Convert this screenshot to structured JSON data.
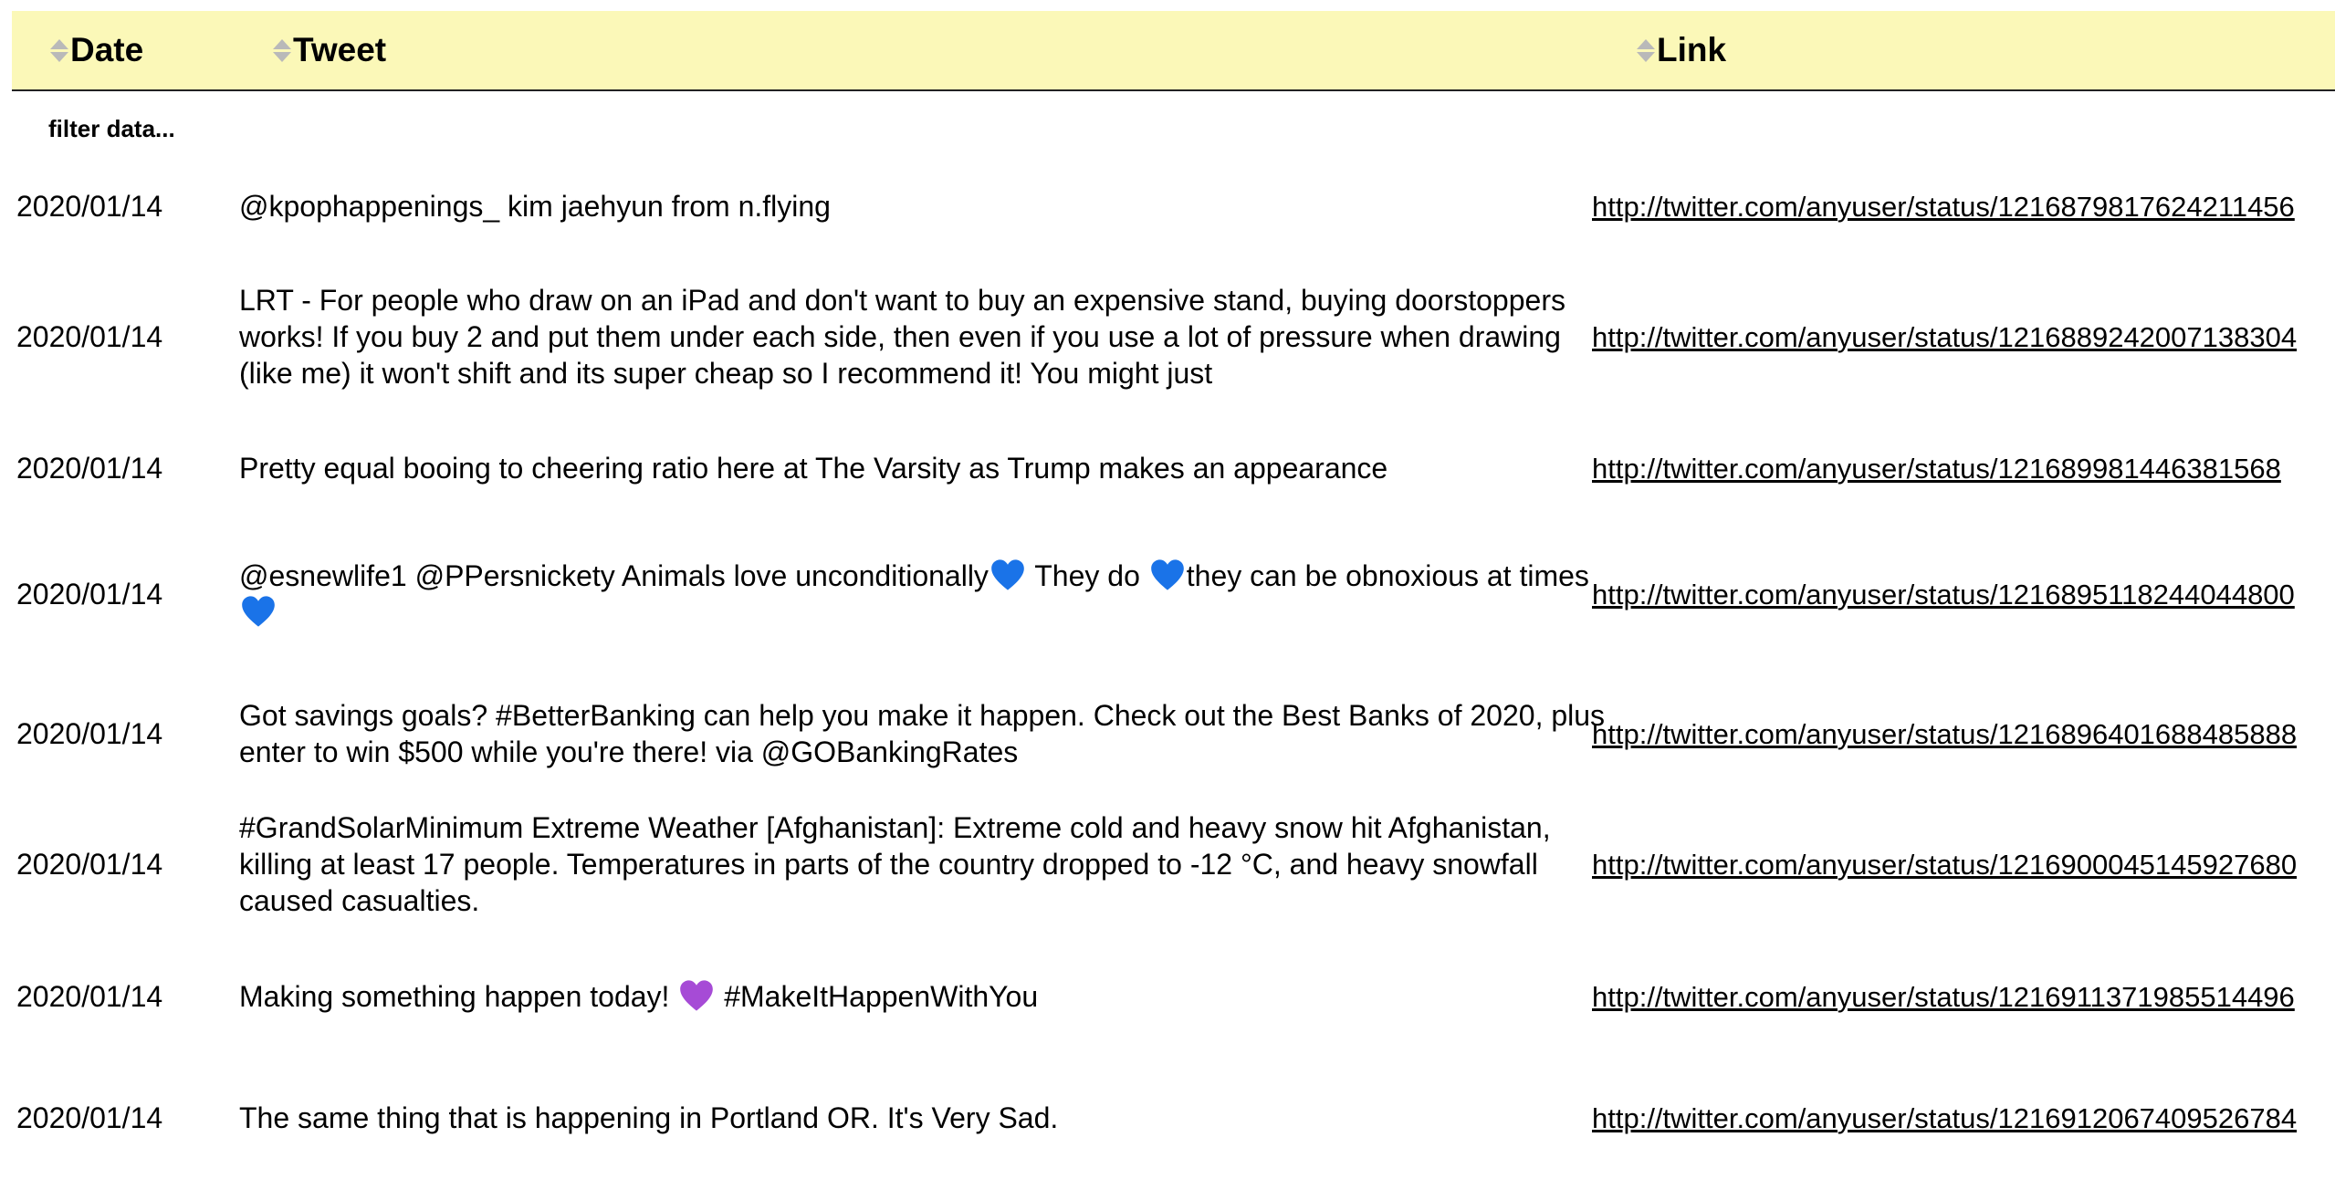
{
  "table": {
    "columns": [
      {
        "label": "Date"
      },
      {
        "label": "Tweet"
      },
      {
        "label": "Link"
      }
    ],
    "filter": {
      "placeholder": "filter data..."
    },
    "rows": [
      {
        "date": "2020/01/14",
        "tweet": "@kpophappenings_ kim jaehyun from n.flying",
        "link": "http://twitter.com/anyuser/status/1216879817624211456"
      },
      {
        "date": "2020/01/14",
        "tweet": "LRT - For people who draw on an iPad and don't want to buy an expensive stand, buying doorstoppers works! If you buy 2 and put them under each side, then even if you use a lot of pressure when drawing (like me) it won't shift and its super cheap so I recommend it! You might just",
        "link": "http://twitter.com/anyuser/status/1216889242007138304"
      },
      {
        "date": "2020/01/14",
        "tweet": "Pretty equal booing to cheering ratio here at The Varsity as Trump makes an appearance",
        "link": "http://twitter.com/anyuser/status/1216899814463815 68"
      },
      {
        "date": "2020/01/14",
        "tweet_parts": [
          "@esnewlife1 @PPersnickety Animals love unconditionally",
          " They do ",
          "they can be obnoxious at times",
          ""
        ],
        "heart_color": "#1a73e8",
        "link": "http://twitter.com/anyuser/status/1216895118244044800"
      },
      {
        "date": "2020/01/14",
        "tweet": "Got savings goals? #BetterBanking can help you make it happen. Check out the Best Banks of 2020, plus enter to win $500 while you're there! via @GOBankingRates",
        "link": "http://twitter.com/anyuser/status/1216896401688485888"
      },
      {
        "date": "2020/01/14",
        "tweet": "#GrandSolarMinimum Extreme Weather [Afghanistan]: Extreme cold and heavy snow hit Afghanistan, killing at least 17 people. Temperatures in parts of the country dropped to -12 °C, and heavy snowfall caused casualties.",
        "link": "http://twitter.com/anyuser/status/1216900045145927680"
      },
      {
        "date": "2020/01/14",
        "tweet_parts": [
          "Making something happen today! ",
          " #MakeItHappenWithYou"
        ],
        "heart_color": "#a64bd6",
        "link": "http://twitter.com/anyuser/status/1216911371985514496"
      },
      {
        "date": "2020/01/14",
        "tweet": "The same thing that is happening in Portland OR. It's Very Sad.",
        "link": "http://twitter.com/anyuser/status/1216912067409526784"
      }
    ]
  },
  "icons": {
    "sort": "sort-icon",
    "blue_heart": "blue-heart-icon",
    "purple_heart": "purple-heart-icon"
  },
  "colors": {
    "header_bg": "#fbf8b8",
    "blue_heart": "#1a73e8",
    "purple_heart": "#a64bd6"
  }
}
